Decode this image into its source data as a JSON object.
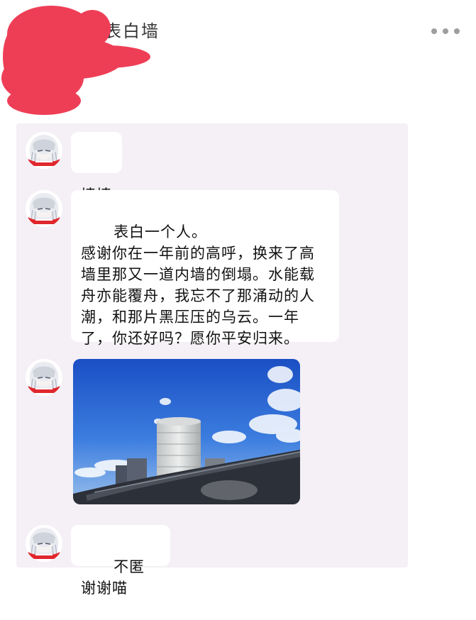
{
  "header": {
    "title": "表白墙",
    "more_icon": "more-horizontal-icon"
  },
  "colors": {
    "redaction": "#ee3e56",
    "chat_background": "#f4f0f5",
    "bubble": "#ffffff",
    "avatar_accent": "#e0272d"
  },
  "messages": [
    {
      "type": "text",
      "avatar_icon": "anime-girl-avatar-icon",
      "text": "墙墙"
    },
    {
      "type": "text",
      "avatar_icon": "anime-girl-avatar-icon",
      "text": "表白一个人。\n感谢你在一年前的高呼，换来了高墙里那又一道内墙的倒塌。水能载舟亦能覆舟，我忘不了那涌动的人潮，和那片黑压压的乌云。一年了，你还好吗？愿你平安归来。"
    },
    {
      "type": "image",
      "avatar_icon": "anime-girl-avatar-icon",
      "image_icon": "city-skyline-photo"
    },
    {
      "type": "text",
      "avatar_icon": "anime-girl-avatar-icon",
      "text": "不匿谢谢喵"
    }
  ]
}
